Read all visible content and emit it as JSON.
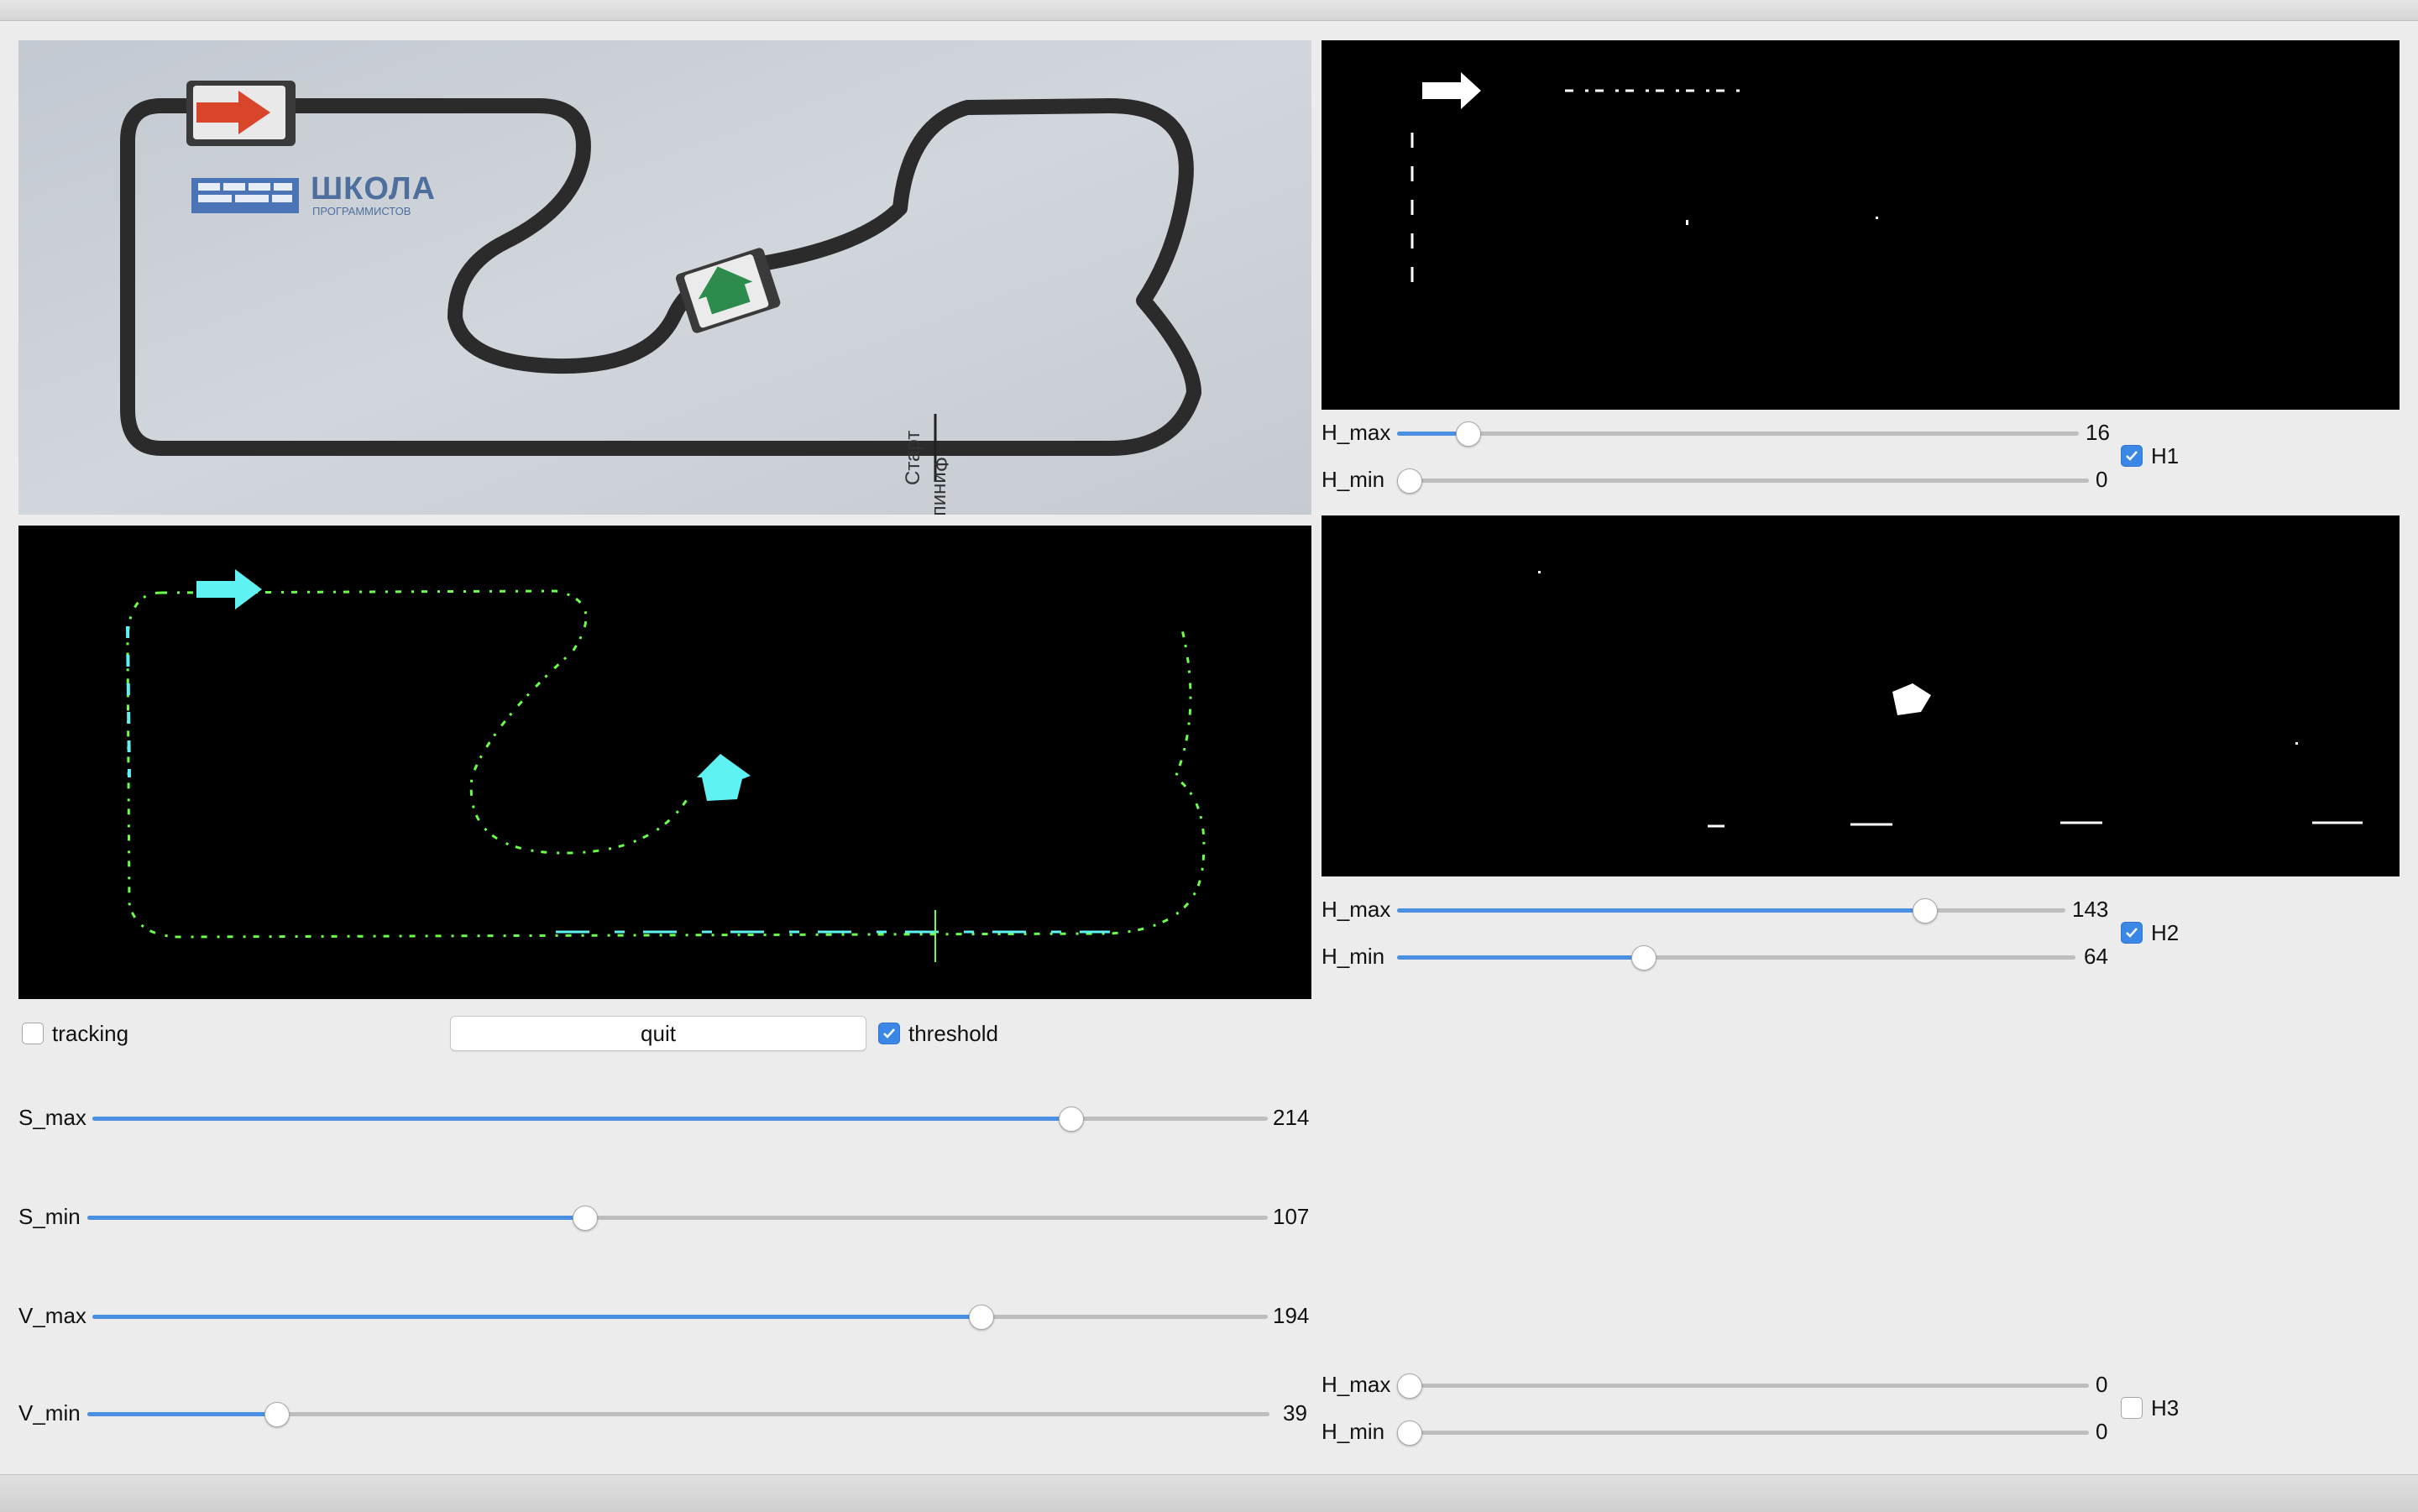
{
  "controls": {
    "tracking": {
      "label": "tracking",
      "checked": false
    },
    "quit": {
      "label": "quit"
    },
    "threshold": {
      "label": "threshold",
      "checked": true
    }
  },
  "camera_view": {
    "logo_text": "ШКОЛА",
    "logo_subtext": "ПРОГРАММИСТОВ",
    "start_label": "Старт",
    "finish_label": "Финиш"
  },
  "sv_sliders": [
    {
      "label": "S_max",
      "value": 214,
      "min": 0,
      "max": 255
    },
    {
      "label": "S_min",
      "value": 107,
      "min": 0,
      "max": 255
    },
    {
      "label": "V_max",
      "value": 194,
      "min": 0,
      "max": 255
    },
    {
      "label": "V_min",
      "value": 39,
      "min": 0,
      "max": 255
    }
  ],
  "hue_groups": [
    {
      "checkbox": {
        "label": "H1",
        "checked": true
      },
      "h_max": {
        "label": "H_max",
        "value": 16,
        "min": 0,
        "max": 179
      },
      "h_min": {
        "label": "H_min",
        "value": 0,
        "min": 0,
        "max": 179
      }
    },
    {
      "checkbox": {
        "label": "H2",
        "checked": true
      },
      "h_max": {
        "label": "H_max",
        "value": 143,
        "min": 0,
        "max": 179
      },
      "h_min": {
        "label": "H_min",
        "value": 64,
        "min": 0,
        "max": 179
      }
    },
    {
      "checkbox": {
        "label": "H3",
        "checked": false
      },
      "h_max": {
        "label": "H_max",
        "value": 0,
        "min": 0,
        "max": 179
      },
      "h_min": {
        "label": "H_min",
        "value": 0,
        "min": 0,
        "max": 179
      }
    }
  ],
  "colors": {
    "accent": "#4a90e2",
    "track_line": "#2b2b2b",
    "mask_cyan": "#5ef2f2",
    "mask_green": "#6cff4a",
    "robot_red_arrow": "#d9452b",
    "robot_green_arrow": "#2e8b4e"
  }
}
